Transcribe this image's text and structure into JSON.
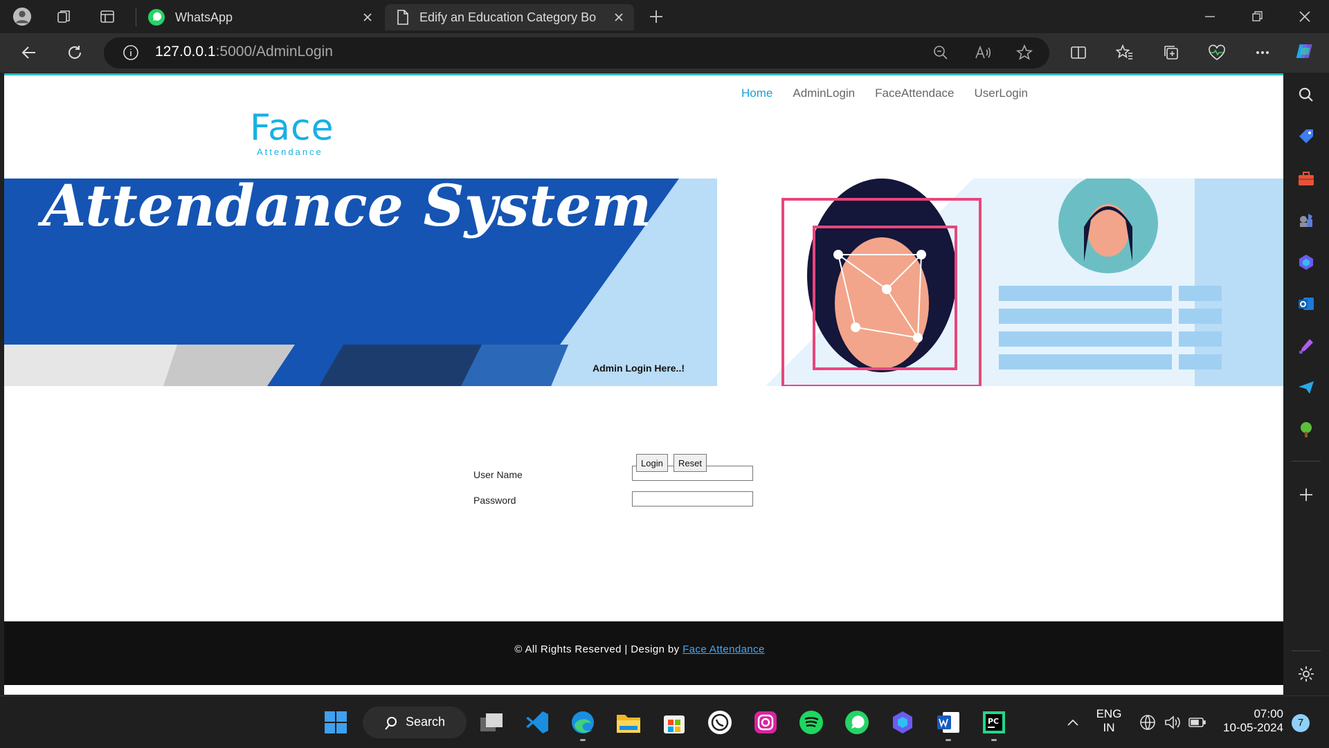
{
  "browser": {
    "tabs": [
      {
        "title": "WhatsApp"
      },
      {
        "title": "Edify an Education Category Boo"
      }
    ],
    "address": {
      "host": "127.0.0.1",
      "path": ":5000/AdminLogin"
    }
  },
  "site": {
    "nav": [
      "Home",
      "AdminLogin",
      "FaceAttendace",
      "UserLogin"
    ],
    "active_nav": "Home",
    "logo": {
      "main": "Face",
      "sub": "Attendance"
    },
    "banner_text": "Attendance System"
  },
  "login": {
    "heading": "Admin Login Here..!",
    "username_label": "User Name",
    "password_label": "Password",
    "login_button": "Login",
    "reset_button": "Reset"
  },
  "footer": {
    "text": "© All Rights Reserved | Design by ",
    "link": "Face Attendance"
  },
  "taskbar": {
    "search_label": "Search",
    "language": "ENG",
    "region": "IN",
    "time": "07:00",
    "date": "10-05-2024",
    "notification_count": "7"
  },
  "colors": {
    "accent": "#18b0e4",
    "banner_blue": "#1554b2",
    "banner_light": "#b9dcf7",
    "footer_bg": "#111111"
  }
}
